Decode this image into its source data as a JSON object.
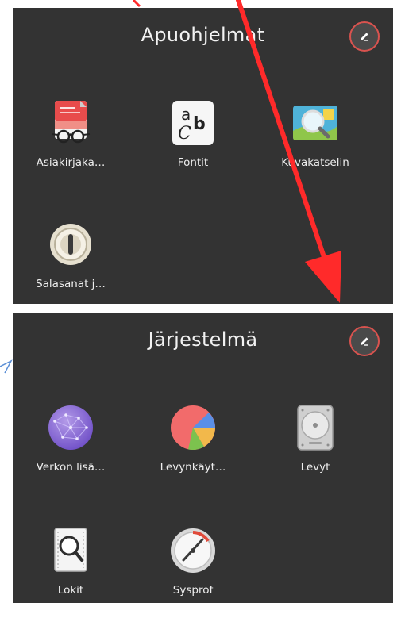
{
  "folders": [
    {
      "title": "Apuohjelmat",
      "apps": [
        {
          "label": "Asiakirjaka…",
          "icon": "document-viewer-icon"
        },
        {
          "label": "Fontit",
          "icon": "fonts-icon"
        },
        {
          "label": "Kuvakatselin",
          "icon": "image-viewer-icon"
        },
        {
          "label": "Salasanat j…",
          "icon": "passwords-keys-icon"
        }
      ]
    },
    {
      "title": "Järjestelmä",
      "apps": [
        {
          "label": "Verkon lisä…",
          "icon": "network-connections-icon"
        },
        {
          "label": "Levynkäyt…",
          "icon": "disk-usage-analyzer-icon"
        },
        {
          "label": "Levyt",
          "icon": "disks-icon"
        },
        {
          "label": "Lokit",
          "icon": "logs-icon"
        },
        {
          "label": "Sysprof",
          "icon": "sysprof-icon"
        }
      ]
    }
  ],
  "fonts_icon_glyphs": {
    "upper": "a",
    "lower": "C",
    "bold": "b"
  },
  "colors": {
    "panel_background": "#333333",
    "edit_button_ring": "#d9534f",
    "annotation_arrow": "#ff2a2a"
  }
}
